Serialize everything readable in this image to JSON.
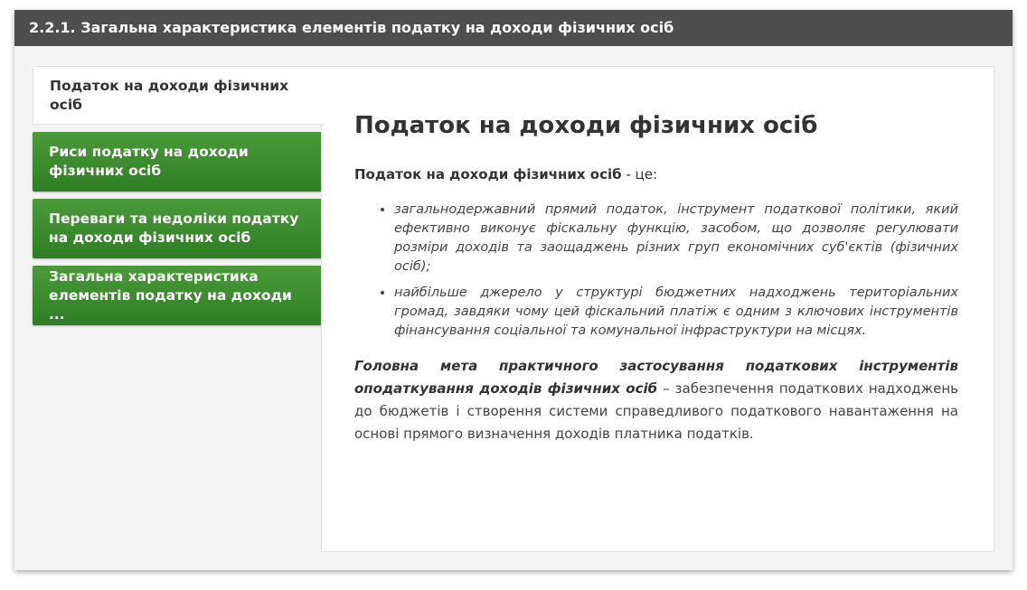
{
  "header": {
    "title": "2.2.1. Загальна характеристика елементів податку на доходи фізичних осіб"
  },
  "tabs": [
    {
      "label": "Податок на доходи фізичних осіб",
      "active": true
    },
    {
      "label": "Риси податку на доходи фізичних осіб",
      "active": false
    },
    {
      "label": "Переваги та недоліки податку на доходи фізичних осіб",
      "active": false
    },
    {
      "label": "Загальна характеристика елементів податку на доходи ...",
      "active": false
    }
  ],
  "content": {
    "heading": "Податок на доходи фізичних осіб",
    "intro_term": "Податок на доходи фізичних осіб",
    "intro_rest": " - це:",
    "bullets": [
      "загальнодержавний прямий податок, інструмент податкової політики, який ефективно виконує фіскальну функцію, засобом, що дозволяє регулювати розміри доходів та заощаджень різних груп економічних суб'єктів (фізичних осіб);",
      "найбільше джерело у структурі бюджетних надходжень територіальних громад, завдяки чому цей фіскальний платіж є одним з ключових інструментів фінансування соціальної та комунальної інфраструктури на місцях."
    ],
    "goal_em": "Головна мета практичного застосування податкових інструментів оподаткування доходів фізичних осіб",
    "goal_rest": " – забезпечення податкових надходжень до бюджетів і створення системи справедливого податкового навантаження на основі прямого визначення доходів платника податків."
  },
  "colors": {
    "titlebar": "#4e4e4e",
    "tab_green": "#3a8a2e",
    "background": "#f3f3f3"
  }
}
